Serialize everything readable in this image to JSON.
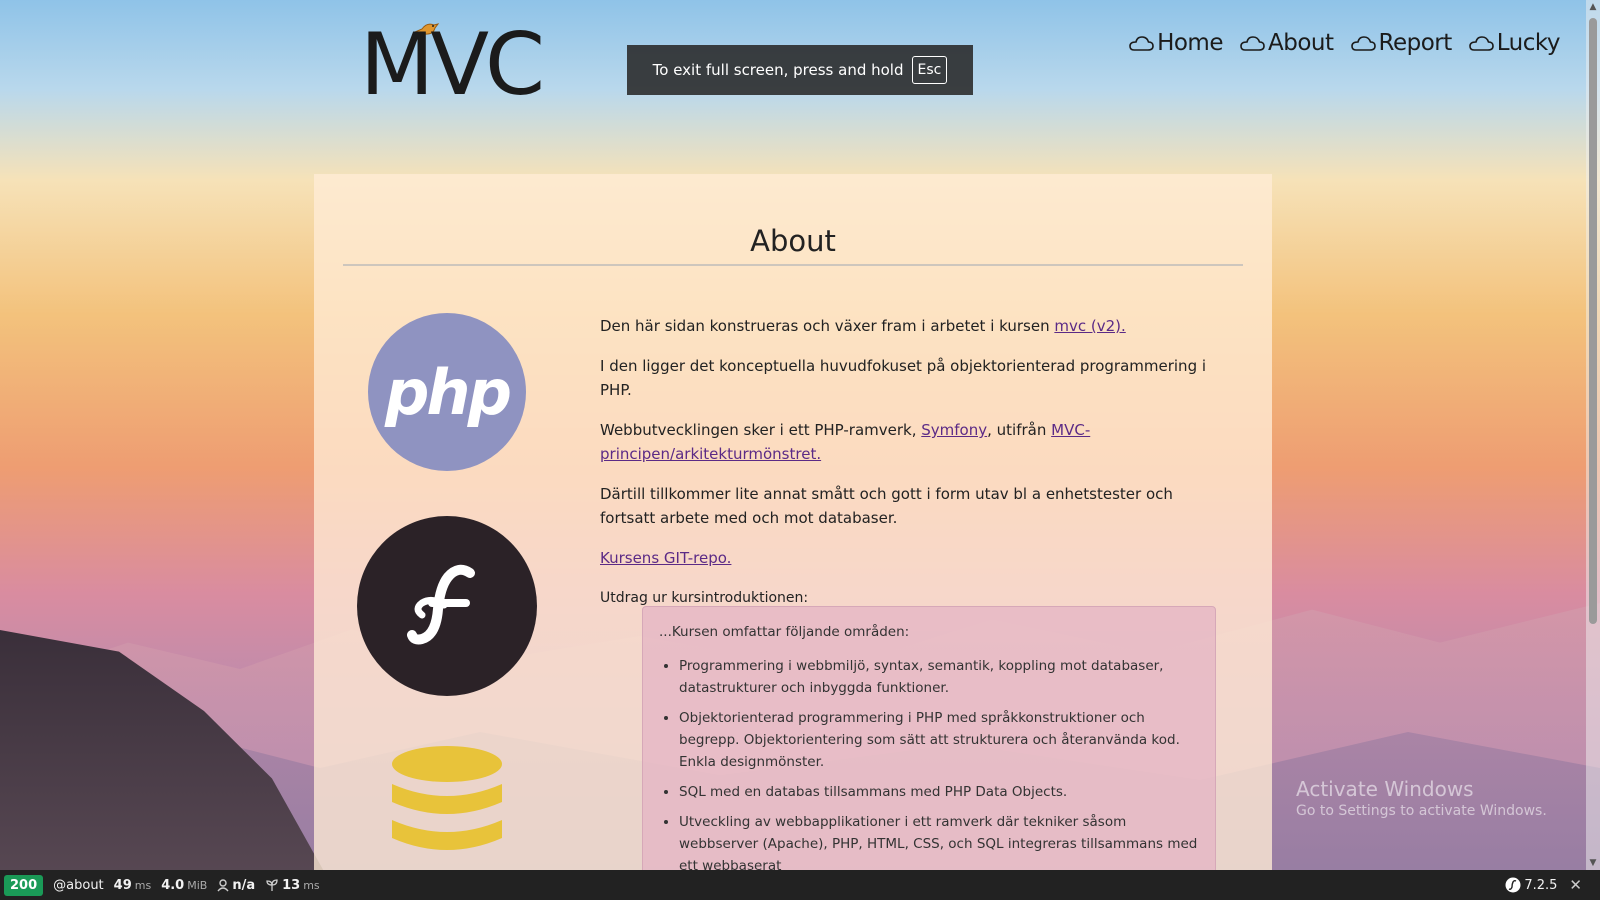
{
  "header": {
    "logo_text": "MVC",
    "fullscreen_notice": "To exit full screen, press and hold",
    "fullscreen_key": "Esc"
  },
  "nav": {
    "items": [
      {
        "label": "Home",
        "icon": "cloud-icon"
      },
      {
        "label": "About",
        "icon": "cloud-icon"
      },
      {
        "label": "Report",
        "icon": "cloud-icon"
      },
      {
        "label": "Lucky",
        "icon": "cloud-icon"
      }
    ]
  },
  "main": {
    "title": "About",
    "icons": [
      "php-logo-icon",
      "symfony-logo-icon",
      "database-icon"
    ],
    "php_text": "php",
    "p1_text": "Den här sidan konstrueras och växer fram i arbetet i kursen ",
    "p1_link": "mvc (v2).",
    "p2_text": "I den ligger det konceptuella huvudfokuset på objektorienterad programmering i PHP.",
    "p3_text": "Webbutvecklingen sker i ett PHP-ramverk, ",
    "p3_link1": "Symfony",
    "p3_mid": ", utifrån ",
    "p3_link2": "MVC-principen/arkitekturmönstret.",
    "p4_text": "Därtill tillkommer lite annat smått och gott i form utav bl a enhetstester och fortsatt arbete med och mot databaser.",
    "git_link": "Kursens GIT-repo.",
    "excerpt_label": "Utdrag ur kursintroduktionen:",
    "quote": {
      "intro": "...Kursen omfattar följande områden:",
      "items": [
        "Programmering i webbmiljö, syntax, semantik, koppling mot databaser, datastrukturer och inbyggda funktioner.",
        "Objektorienterad programmering i PHP med språkkonstruktioner och begrepp. Objektorientering som sätt att strukturera och återanvända kod. Enkla designmönster.",
        "SQL med en databas tillsammans med PHP Data Objects.",
        "Utveckling av webbapplikationer i ett ramverk där tekniker såsom webbserver (Apache), PHP, HTML, CSS, och SQL integreras tillsammans med ett webbaserat"
      ]
    }
  },
  "watermark": {
    "line1": "Activate Windows",
    "line2": "Go to Settings to activate Windows."
  },
  "toolbar": {
    "status": "200",
    "route": "@about",
    "time_value": "49",
    "time_unit": "ms",
    "memory_value": "4.0",
    "memory_unit": "MiB",
    "user": "n/a",
    "init_value": "13",
    "init_unit": "ms",
    "version": "7.2.5",
    "status_color": "#1a9a57"
  }
}
